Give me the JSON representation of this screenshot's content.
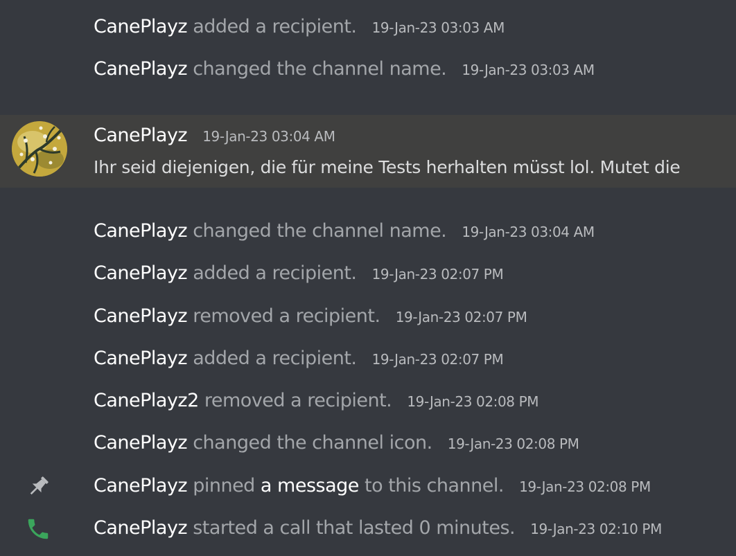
{
  "events_top": [
    {
      "user": "CanePlayz",
      "action": "added a recipient.",
      "time": "19-Jan-23 03:03 AM"
    },
    {
      "user": "CanePlayz",
      "action": "changed the channel name.",
      "time": "19-Jan-23 03:03 AM"
    }
  ],
  "message": {
    "user": "CanePlayz",
    "time": "19-Jan-23 03:04 AM",
    "text": "Ihr seid diejenigen, die für meine Tests herhalten müsst lol. Mutet die"
  },
  "events_bottom": [
    {
      "user": "CanePlayz",
      "action": "changed the channel name.",
      "time": "19-Jan-23 03:04 AM"
    },
    {
      "user": "CanePlayz",
      "action": "added a recipient.",
      "time": "19-Jan-23 02:07 PM"
    },
    {
      "user": "CanePlayz",
      "action": "removed a recipient.",
      "time": "19-Jan-23 02:07 PM"
    },
    {
      "user": "CanePlayz",
      "action": "added a recipient.",
      "time": "19-Jan-23 02:07 PM"
    },
    {
      "user": "CanePlayz2",
      "action": "removed a recipient.",
      "time": "19-Jan-23 02:08 PM"
    },
    {
      "user": "CanePlayz",
      "action": "changed the channel icon.",
      "time": "19-Jan-23 02:08 PM"
    }
  ],
  "pin_event": {
    "user": "CanePlayz",
    "action_before": "pinned",
    "link": "a message",
    "action_after": "to this channel.",
    "time": "19-Jan-23 02:08 PM",
    "icon": "pin-icon"
  },
  "call_event": {
    "user": "CanePlayz",
    "action": "started a call that lasted 0 minutes.",
    "time": "19-Jan-23 02:10 PM",
    "icon": "phone-icon"
  },
  "colors": {
    "background": "#36393f",
    "highlight": "#40403f",
    "username": "#ffffff",
    "action": "#a3a6aa",
    "timestamp": "#b9bbbe",
    "call_green": "#3ba55c",
    "pin_gray": "#b9bbbe"
  }
}
